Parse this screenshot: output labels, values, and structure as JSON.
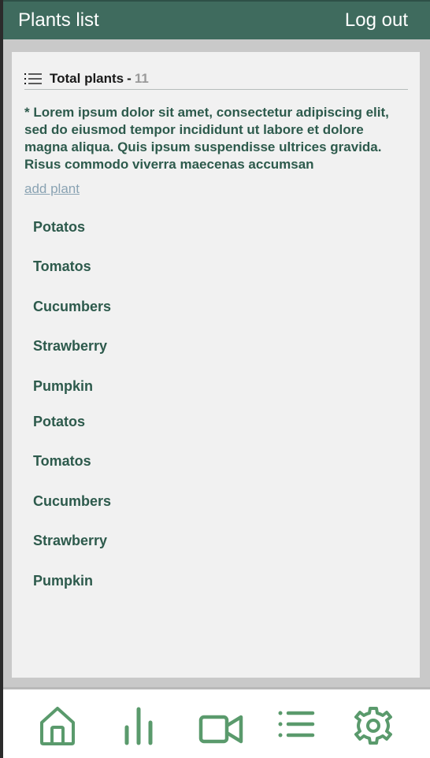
{
  "header": {
    "title": "Plants list",
    "logout_label": "Log out"
  },
  "summary": {
    "label": "Total plants",
    "separator": "-",
    "count": "11"
  },
  "description": "* Lorem ipsum dolor sit amet, consectetur adipiscing elit, sed do eiusmod tempor incididunt ut labore et dolore magna aliqua. Quis ipsum suspendisse ultrices gravida. Risus commodo viverra maecenas accumsan",
  "add_plant_label": "add plant",
  "plants": [
    "Potatos",
    "Tomatos",
    "Cucumbers",
    "Strawberry",
    "Pumpkin",
    "Potatos",
    "Tomatos",
    "Cucumbers",
    "Strawberry",
    "Pumpkin"
  ],
  "bottom_nav": [
    {
      "icon": "home-icon"
    },
    {
      "icon": "bar-chart-icon"
    },
    {
      "icon": "video-camera-icon"
    },
    {
      "icon": "list-icon"
    },
    {
      "icon": "settings-gear-icon"
    }
  ],
  "colors": {
    "header_bg": "#3f6b5e",
    "accent": "#2d5a4c",
    "icon_green": "#5a9a6c",
    "link": "#8aa3b3"
  }
}
